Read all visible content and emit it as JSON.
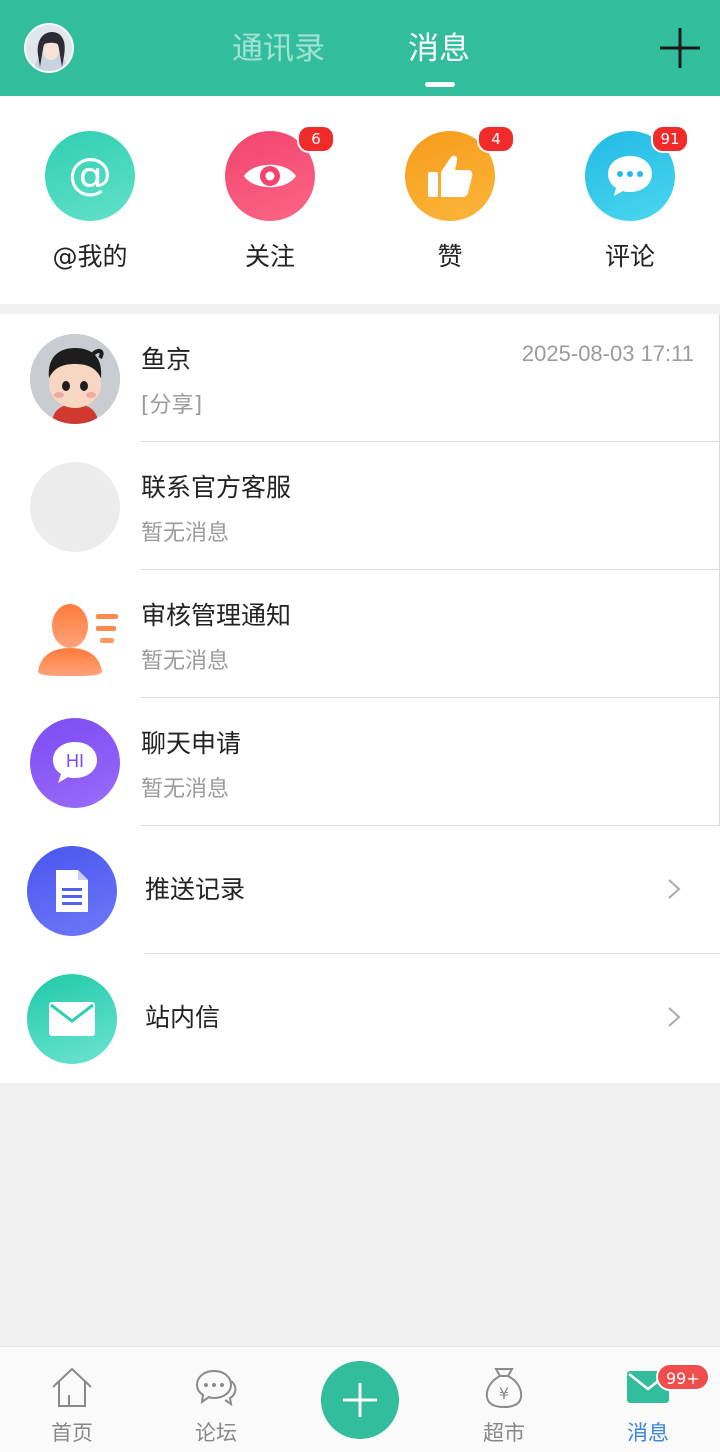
{
  "header": {
    "tab_contacts": "通讯录",
    "tab_messages": "消息"
  },
  "quick": [
    {
      "label": "@我的",
      "icon": "at-icon",
      "color": "#2fcfb2"
    },
    {
      "label": "关注",
      "icon": "eye-icon",
      "color": "#f2446f",
      "badge": "6"
    },
    {
      "label": "赞",
      "icon": "thumbs-up-icon",
      "color": "#f9a623",
      "badge": "4"
    },
    {
      "label": "评论",
      "icon": "chat-bubble-icon",
      "color": "#2fc7e8",
      "badge": "91"
    }
  ],
  "messages": [
    {
      "title": "鱼京",
      "sub": "[分享]",
      "time": "2025-08-03 17:11"
    },
    {
      "title": "联系官方客服",
      "sub": "暂无消息"
    },
    {
      "title": "审核管理通知",
      "sub": "暂无消息"
    },
    {
      "title": "聊天申请",
      "sub": "暂无消息",
      "icon_text": "HI"
    }
  ],
  "links": [
    {
      "title": "推送记录",
      "icon": "document-icon"
    },
    {
      "title": "站内信",
      "icon": "envelope-icon"
    }
  ],
  "nav": {
    "home": "首页",
    "forum": "论坛",
    "market": "超市",
    "messages": "消息",
    "messages_badge": "99+"
  },
  "colors": {
    "brand": "#32be9c",
    "active_nav": "#3a86d8",
    "badge": "#f12a2a"
  }
}
